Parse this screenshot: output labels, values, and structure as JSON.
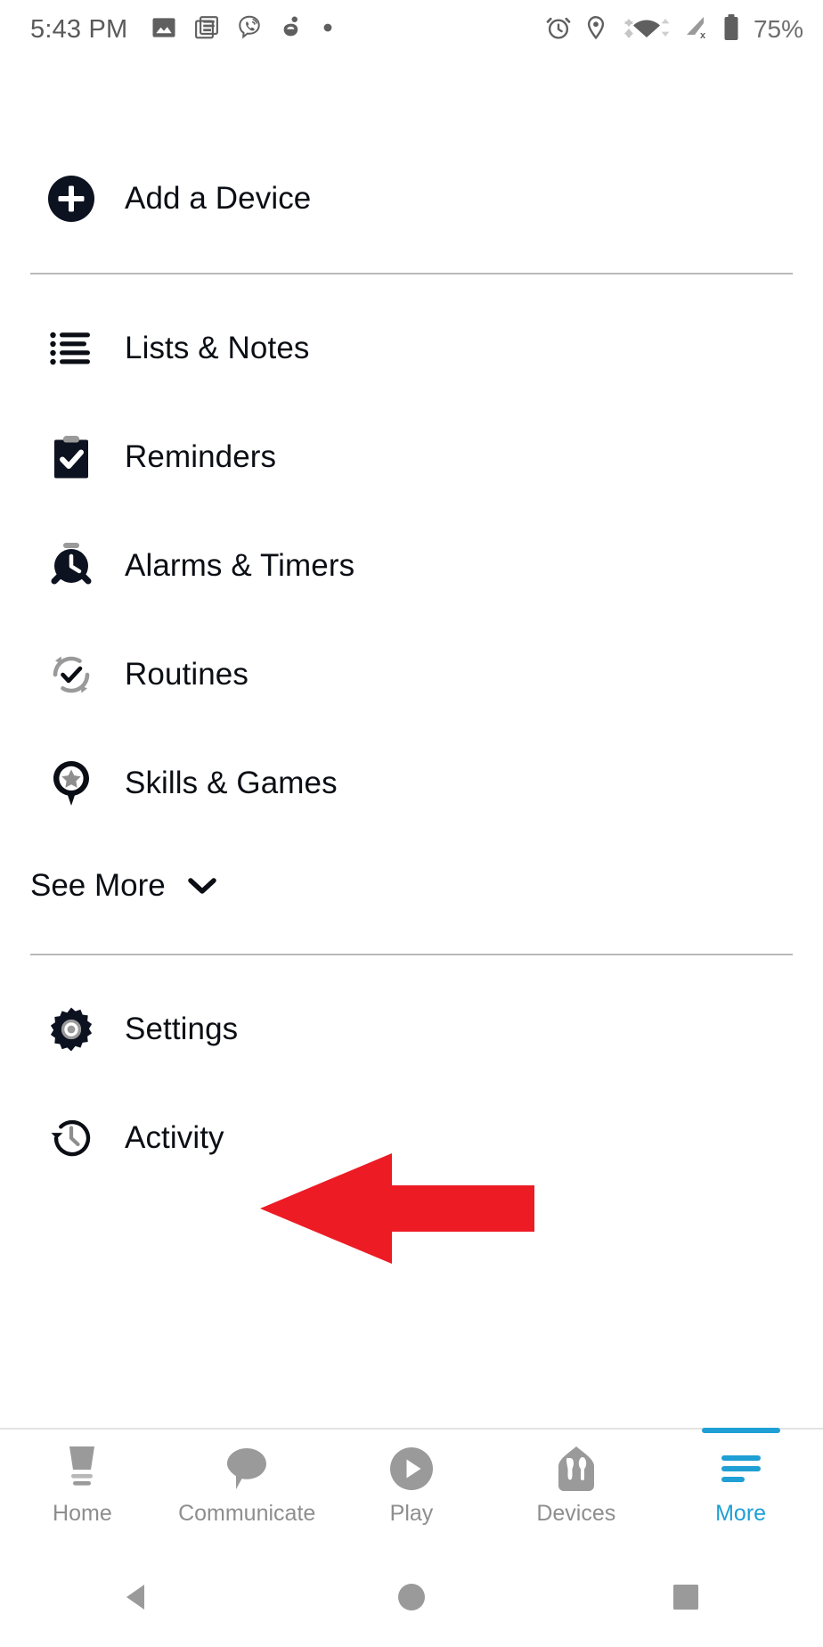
{
  "status_bar": {
    "time": "5:43 PM",
    "battery_percent": "75%",
    "left_icons": [
      {
        "name": "photo-icon",
        "label": "Photos"
      },
      {
        "name": "news-reader-icon",
        "label": "Reader"
      },
      {
        "name": "viber-call-icon",
        "label": "Viber"
      },
      {
        "name": "evernote-icon",
        "label": "Evernote"
      },
      {
        "name": "dot-indicator-icon",
        "label": "More notifications"
      }
    ],
    "right_icons": [
      {
        "name": "alarm-clock-icon",
        "label": "Alarm set"
      },
      {
        "name": "location-pin-icon",
        "label": "Location"
      },
      {
        "name": "wifi-icon",
        "label": "Wi-Fi"
      },
      {
        "name": "cellular-signal-off-icon",
        "label": "No SIM"
      },
      {
        "name": "battery-icon",
        "label": "Battery"
      }
    ],
    "colors": {
      "icon_gray": "#5f5f5f",
      "text_gray": "#5a5a5a"
    }
  },
  "menu": {
    "add_device": {
      "label": "Add a Device",
      "icon": "plus-circle-icon"
    },
    "primary_items": [
      {
        "label": "Lists & Notes",
        "icon": "bulleted-list-icon"
      },
      {
        "label": "Reminders",
        "icon": "clipboard-check-icon"
      },
      {
        "label": "Alarms & Timers",
        "icon": "alarm-clock-icon"
      },
      {
        "label": "Routines",
        "icon": "refresh-check-icon"
      },
      {
        "label": "Skills & Games",
        "icon": "star-pin-icon"
      }
    ],
    "see_more": {
      "label": "See More",
      "icon": "chevron-down-icon"
    },
    "secondary_items": [
      {
        "label": "Settings",
        "icon": "gear-icon"
      },
      {
        "label": "Activity",
        "icon": "history-clock-icon"
      }
    ]
  },
  "annotation": {
    "arrow": {
      "name": "red-pointer-arrow",
      "direction": "left",
      "points_to": "Settings",
      "color": "#ED1B24"
    }
  },
  "tab_bar": {
    "active": "More",
    "accent_color": "#1f9fd4",
    "inactive_color": "#8e8e8e",
    "tabs": [
      {
        "label": "Home",
        "icon": "echo-device-icon",
        "active": false
      },
      {
        "label": "Communicate",
        "icon": "speech-bubble-icon",
        "active": false
      },
      {
        "label": "Play",
        "icon": "play-circle-icon",
        "active": false
      },
      {
        "label": "Devices",
        "icon": "devices-house-icon",
        "active": false
      },
      {
        "label": "More",
        "icon": "hamburger-lines-icon",
        "active": true
      }
    ]
  },
  "nav_bar": {
    "buttons": [
      {
        "label": "Back",
        "icon": "nav-back-triangle-icon"
      },
      {
        "label": "Home",
        "icon": "nav-home-circle-icon"
      },
      {
        "label": "Recents",
        "icon": "nav-recents-square-icon"
      }
    ],
    "color": "#9a9a9a"
  }
}
